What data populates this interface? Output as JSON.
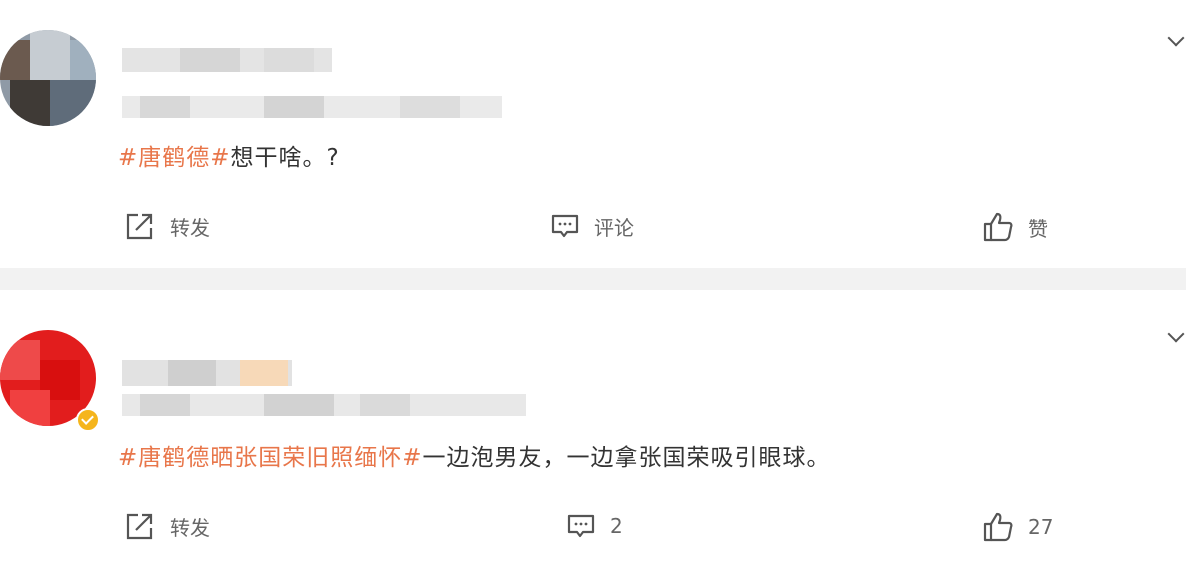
{
  "posts": [
    {
      "content_topic": "#唐鹤德#",
      "content_text": "想干啥。?",
      "actions": {
        "repost": "转发",
        "comment": "评论",
        "like": "赞"
      }
    },
    {
      "content_topic": "#唐鹤德晒张国荣旧照缅怀#",
      "content_text": "一边泡男友，一边拿张国荣吸引眼球。",
      "actions": {
        "repost": "转发",
        "comment": "2",
        "like": "27"
      }
    }
  ],
  "colors": {
    "topic": "#e8764a",
    "text": "#333333",
    "action": "#666666",
    "divider": "#f2f2f2",
    "verified": "#f5b51c"
  }
}
